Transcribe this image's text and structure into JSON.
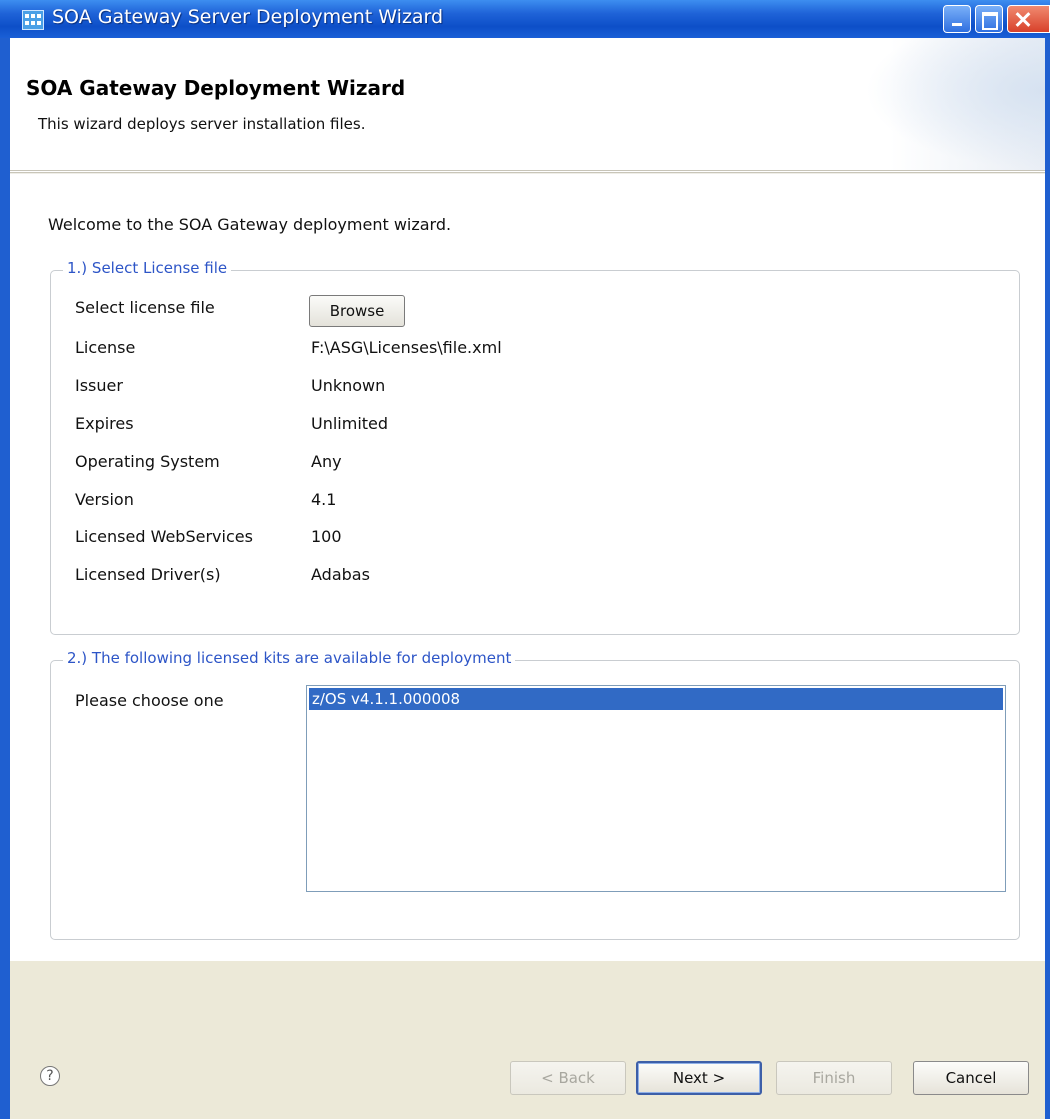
{
  "window": {
    "title": "SOA Gateway Server Deployment Wizard"
  },
  "header": {
    "title": "SOA Gateway Deployment Wizard",
    "description": "This wizard deploys server installation files."
  },
  "welcome": "Welcome to the SOA Gateway deployment wizard.",
  "license_group": {
    "legend": "1.) Select License file",
    "select_label": "Select license file",
    "browse_label": "Browse",
    "rows": [
      {
        "label": "License",
        "value": "F:\\ASG\\Licenses\\file.xml"
      },
      {
        "label": "Issuer",
        "value": "Unknown"
      },
      {
        "label": "Expires",
        "value": "Unlimited"
      },
      {
        "label": "Operating System",
        "value": "Any"
      },
      {
        "label": "Version",
        "value": "4.1"
      },
      {
        "label": "Licensed WebServices",
        "value": "100"
      },
      {
        "label": "Licensed Driver(s)",
        "value": "Adabas"
      }
    ]
  },
  "kits_group": {
    "legend": "2.) The following licensed kits are available for deployment",
    "choose_label": "Please choose one",
    "kits": [
      "z/OS v4.1.1.000008"
    ]
  },
  "footer": {
    "help_glyph": "?",
    "back_label": "< Back",
    "next_label": "Next >",
    "finish_label": "Finish",
    "cancel_label": "Cancel"
  }
}
